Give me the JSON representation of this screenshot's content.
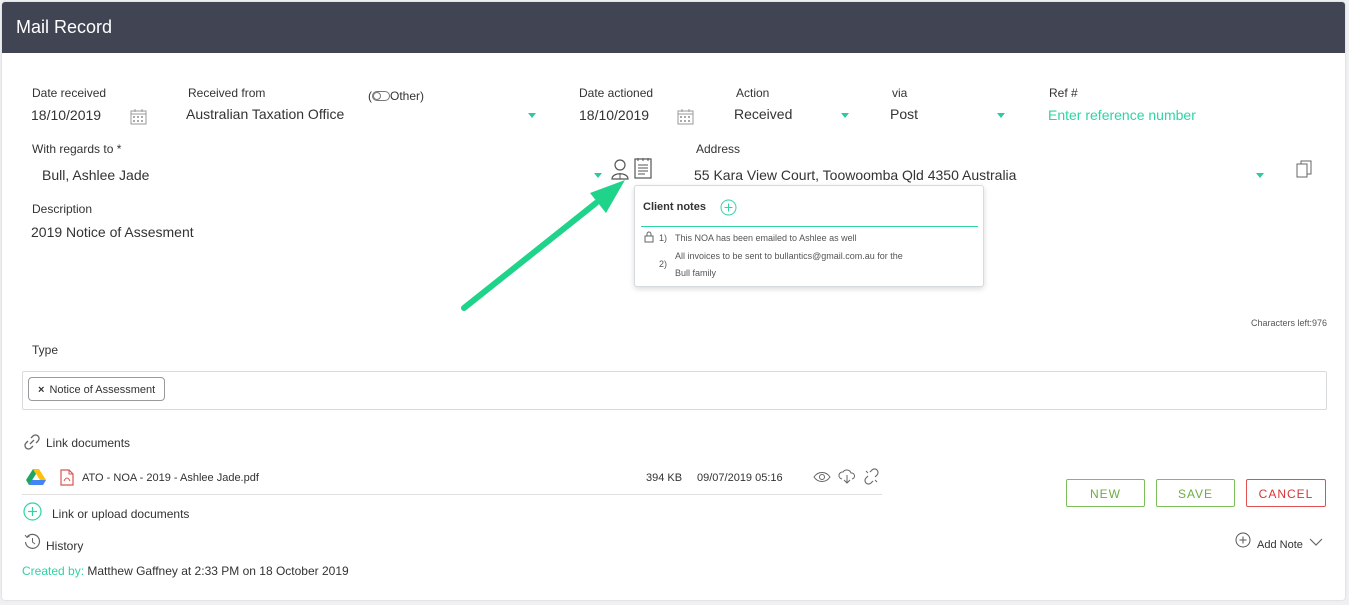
{
  "header": {
    "title": "Mail Record"
  },
  "fields": {
    "date_received": {
      "label": "Date received",
      "value": "18/10/2019"
    },
    "received_from": {
      "label": "Received from",
      "toggle_label": "Other",
      "value": "Australian Taxation Office"
    },
    "date_actioned": {
      "label": "Date actioned",
      "value": "18/10/2019"
    },
    "action": {
      "label": "Action",
      "value": "Received"
    },
    "via": {
      "label": "via",
      "value": "Post"
    },
    "ref": {
      "label": "Ref #",
      "placeholder": "Enter reference number"
    },
    "with_regards_to": {
      "label": "With regards to *",
      "value": "Bull, Ashlee Jade"
    },
    "address": {
      "label": "Address",
      "value": "55 Kara View Court, Toowoomba Qld 4350 Australia"
    },
    "description": {
      "label": "Description",
      "value": "2019 Notice of Assesment"
    },
    "characters_left": "Characters left:976",
    "type": {
      "label": "Type",
      "tags": [
        "Notice of Assessment"
      ]
    }
  },
  "client_notes": {
    "title": "Client notes",
    "notes": [
      {
        "num": "1)",
        "text": "This NOA has been emailed to Ashlee as well",
        "locked": true
      },
      {
        "num": "2)",
        "text_line1": "All invoices to be sent to bullantics@gmail.com.au for the",
        "text_line2": "Bull family",
        "locked": false
      }
    ]
  },
  "documents": {
    "link_label": "Link documents",
    "files": [
      {
        "name": "ATO - NOA - 2019 - Ashlee Jade.pdf",
        "size": "394 KB",
        "date": "09/07/2019 05:16"
      }
    ],
    "upload_label": "Link or upload documents"
  },
  "history": {
    "label": "History",
    "created_prefix": "Created by:",
    "created_text": "Matthew Gaffney at 2:33 PM on 18 October 2019"
  },
  "actions": {
    "new": "NEW",
    "save": "SAVE",
    "cancel": "CANCEL",
    "add_note": "Add Note"
  },
  "colors": {
    "header_bg": "#404453",
    "accent": "#2dd4a4",
    "save": "#6aae44",
    "cancel": "#d93535",
    "annotation_arrow": "#1fd38a"
  }
}
